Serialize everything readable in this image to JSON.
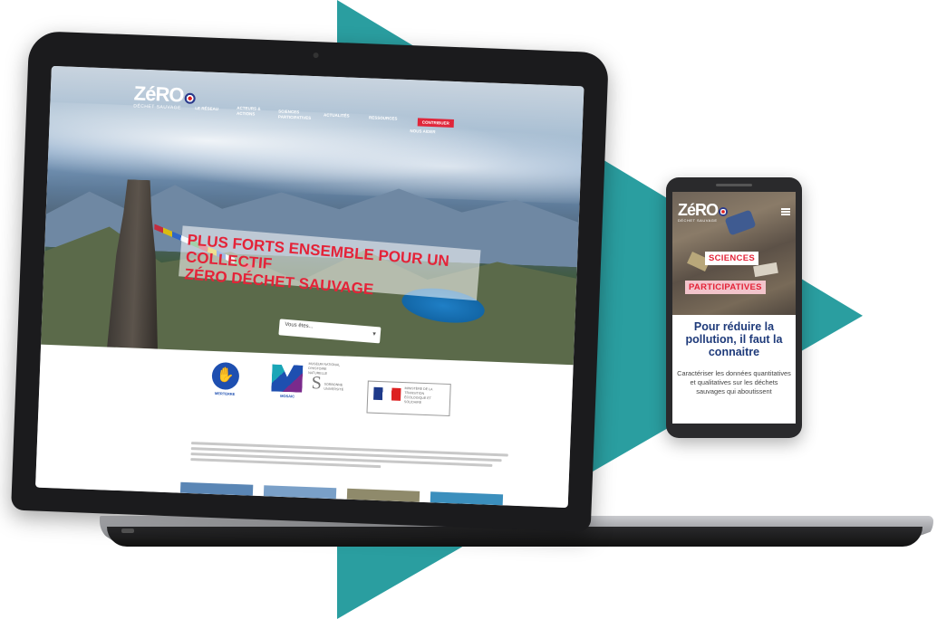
{
  "theme": {
    "accent_teal": "#2a9ea0",
    "brand_red": "#e42338",
    "brand_navy": "#1e3a7a"
  },
  "site": {
    "logo_word": "ZéRO",
    "logo_sub": "DÉCHET SAUVAGE",
    "nav": [
      "LE RÉSEAU",
      "ACTEURS & ACTIONS",
      "SCIENCES PARTICIPATIVES",
      "ACTUALITÉS",
      "RESSOURCES",
      "NOUS AIDER"
    ],
    "nav_cta": "CONTRIBUER",
    "hero_headline_line1": "PLUS FORTS ENSEMBLE POUR UN COLLECTIF",
    "hero_headline_line2": "ZÉRO DÉCHET SAUVAGE",
    "select_placeholder": "Vous êtes...",
    "partners": {
      "merterre": "MERTERRE",
      "mosaic": "MOSAIC",
      "museum": "MUSÉUM NATIONAL D'HISTOIRE NATURELLE",
      "sorbonne": "SORBONNE UNIVERSITÉ",
      "ministry": "MINISTÈRE DE LA TRANSITION ÉCOLOGIQUE ET SOLIDAIRE"
    }
  },
  "phone": {
    "logo_word": "ZéRO",
    "logo_sub": "DÉCHET SAUVAGE",
    "tag1": "SCIENCES",
    "tag2": "PARTICIPATIVES",
    "title": "Pour réduire la pollution, il faut la connaitre",
    "body": "Caractériser les données quantitatives et qualitatives sur les déchets sauvages qui aboutissent"
  }
}
